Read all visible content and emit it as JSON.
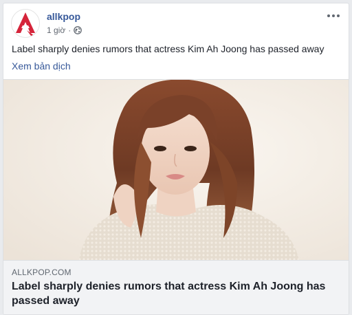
{
  "post": {
    "page_name": "allkpop",
    "timestamp": "1 giờ",
    "separator": "·",
    "privacy_icon": "globe-icon",
    "more_icon": "more-horizontal-icon",
    "text": "Label sharply denies rumors that actress Kim Ah Joong has passed away",
    "see_translation": "Xem bản dịch"
  },
  "link_preview": {
    "domain": "ALLKPOP.COM",
    "title": "Label sharply denies rumors that actress Kim Ah Joong has passed away",
    "image": "woman-portrait-photo"
  },
  "colors": {
    "brand_logo": "#d5243a",
    "link_blue": "#365899",
    "card_bg": "#ffffff",
    "page_bg": "#e9ebee",
    "link_info_bg": "#f2f3f5"
  }
}
